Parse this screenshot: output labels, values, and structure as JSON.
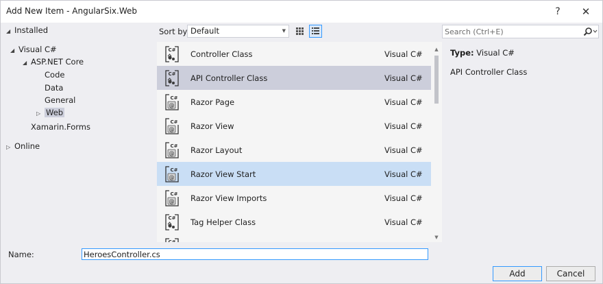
{
  "window": {
    "title": "Add New Item - AngularSix.Web",
    "help_label": "?",
    "close_label": "✕"
  },
  "tree": [
    {
      "label": "Installed",
      "arrow": "◢",
      "level": 0,
      "selected": false
    },
    {
      "label": "Visual C#",
      "arrow": "◢",
      "level": 1,
      "selected": false
    },
    {
      "label": "ASP.NET Core",
      "arrow": "◢",
      "level": 2,
      "selected": false
    },
    {
      "label": "Code",
      "arrow": "",
      "level": 3,
      "selected": false
    },
    {
      "label": "Data",
      "arrow": "",
      "level": 3,
      "selected": false
    },
    {
      "label": "General",
      "arrow": "",
      "level": 3,
      "selected": false
    },
    {
      "label": "Web",
      "arrow": "▷",
      "level": 3,
      "selected": true
    },
    {
      "label": "Xamarin.Forms",
      "arrow": "",
      "level": 2,
      "selected": false
    },
    {
      "label": "Online",
      "arrow": "▷",
      "level": 0,
      "selected": false
    }
  ],
  "toolbar": {
    "sort_label": "Sort by:",
    "sort_value": "Default",
    "view_icons": [
      "grid-view-icon",
      "list-view-icon"
    ]
  },
  "search": {
    "placeholder": "Search (Ctrl+E)",
    "icon": "search-icon"
  },
  "templates": [
    {
      "name": "Controller Class",
      "language": "Visual C#",
      "icon": "csharp-class-icon",
      "state": ""
    },
    {
      "name": "API Controller Class",
      "language": "Visual C#",
      "icon": "csharp-class-icon",
      "state": "selected-inactive"
    },
    {
      "name": "Razor Page",
      "language": "Visual C#",
      "icon": "razor-file-icon",
      "state": ""
    },
    {
      "name": "Razor View",
      "language": "Visual C#",
      "icon": "razor-file-icon",
      "state": ""
    },
    {
      "name": "Razor Layout",
      "language": "Visual C#",
      "icon": "razor-file-icon",
      "state": ""
    },
    {
      "name": "Razor View Start",
      "language": "Visual C#",
      "icon": "razor-file-icon",
      "state": "hover"
    },
    {
      "name": "Razor View Imports",
      "language": "Visual C#",
      "icon": "razor-file-icon",
      "state": ""
    },
    {
      "name": "Tag Helper Class",
      "language": "Visual C#",
      "icon": "csharp-class-icon",
      "state": ""
    },
    {
      "name": "",
      "language": "",
      "icon": "csharp-class-icon",
      "state": ""
    }
  ],
  "details": {
    "type_label": "Type:",
    "type_value": "Visual C#",
    "description": "API Controller Class"
  },
  "name_field": {
    "label": "Name:",
    "value": "HeroesController.cs"
  },
  "buttons": {
    "add": "Add",
    "cancel": "Cancel"
  },
  "colors": {
    "selection_inactive": "#cccedb",
    "hover": "#c9def5",
    "accent": "#3399ff",
    "background": "#eeeef2"
  }
}
